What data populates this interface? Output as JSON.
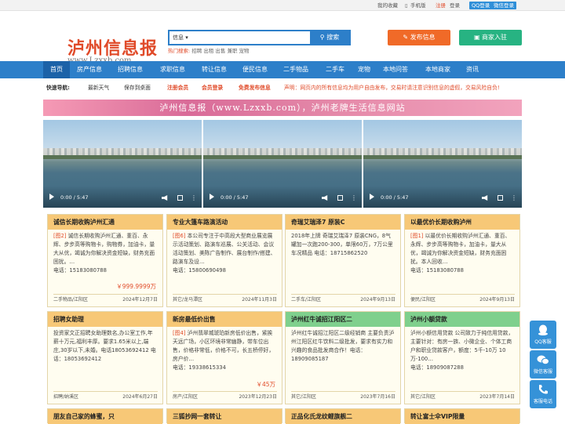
{
  "topbar": {
    "favorite": "我的收藏",
    "mobile": "手机版",
    "register": "注册",
    "login": "登录",
    "qq_login": "QQ登录",
    "wechat_login": "微信登录"
  },
  "logo": {
    "cn": "泸州信息报",
    "en": "www.Lzxxb.com"
  },
  "search": {
    "type": "信息",
    "button": "搜索",
    "placeholder": "",
    "hot_label": "热门搜索:",
    "hot_terms": "招聘 出租 出售 兼职 宠物"
  },
  "actions": {
    "publish": "发布信息",
    "join": "商家入驻"
  },
  "nav": [
    "首页",
    "房产信息",
    "招聘信息",
    "求职信息",
    "转让信息",
    "便民信息",
    "二手物品",
    "二手车",
    "宠物",
    "本地问答",
    "本地商家",
    "资讯"
  ],
  "quick": {
    "label": "快速导航:",
    "weather": "最新天气",
    "save_desktop": "保存到桌面",
    "register": "注册会员",
    "login": "会员登录",
    "free": "免费发布信息",
    "notice": "声明：网页内的所有信息均为用户自由发布，交易时请注意识别信息的虚假，交易风险自负!"
  },
  "banner": "泸州信息报（www.Lzxxb.com），泸州老牌生活信息网站",
  "video": {
    "time": "0:00 / 5:47"
  },
  "cards": [
    {
      "title": "诚信长期收购泸州汇通",
      "tag": "[图2]",
      "body": " 诚信长期收购泸州汇通、重百、永辉、步步高等购物卡，购物券，加油卡，量大从优，竭诚为你解决资金短缺，财务充面困扰。…",
      "phone": "电话：15183080788",
      "price": "￥999.9999万",
      "cat": "二手物品/江阳区",
      "date": "2024年12月7日"
    },
    {
      "title": "专业大篷车路演活动",
      "tag": "[图6]",
      "body": " 本公司专注于中高段大型商业展览展示活动策划、路演车巡展、公关活动、会议活动策划、美陈广告制作、展台制作/搭建、路演车及设…",
      "phone": "电话：15800690498",
      "price": "",
      "cat": "其它/龙马潭区",
      "date": "2024年11月3日"
    },
    {
      "title": "奇瑞艾瑞泽7 原装C",
      "tag": "",
      "body": "2018年上牌 奇瑞艾瑞泽7 原装CNG，8气罐加一次跑200-300，单限60万，7万公里车况精品 电话：18715862520",
      "phone": "",
      "price": "",
      "cat": "二手车/江阳区",
      "date": "2024年9月13日"
    },
    {
      "title": "以最优价长期收购泸州",
      "tag": "[图1]",
      "body": " 以最优价长期收购泸州汇通、重百、永辉、步步高等购物卡，加油卡，量大从优，竭诚为你解决资金短缺，财务充面困扰。本人回收…",
      "phone": "电话：15183080788",
      "price": "",
      "cat": "便民/江阳区",
      "date": "2024年9月13日"
    },
    {
      "title": "招聘女助理",
      "tag": "",
      "body": "投资家文正招聘女助理数名,办公室工作,年薪十万元,福利丰厚。要求1.65米以上,端庄,30岁以下,未婚。电话18053692412 电话：18053692412",
      "phone": "",
      "price": "",
      "cat": "招聘/纳溪区",
      "date": "2024年6月27日"
    },
    {
      "title": "新房最低价出售",
      "tag": "[图4]",
      "body": " 泸州翡翠城琥珀新房低价出售，紧挨天远广场，小区环境非常幽静，带车位出售，价格非常低，价格不可，长五桥停好，房户价…",
      "phone": "电话：19338615334",
      "price": "￥45万",
      "cat": "房产/江阳区",
      "date": "2023年12月23日"
    },
    {
      "title": "泸州红牛诚招江阳区二",
      "tag": "",
      "body": "泸州红牛诚招江阳区二级经销商 主要负责泸州江阳区红牛饮料二级批发，要求有实力和兴趣的食品批发商合作！电话：18909085187",
      "phone": "",
      "price": "",
      "cat": "其它/江阳区",
      "date": "2023年7月16日"
    },
    {
      "title": "泸州小额贷款",
      "tag": "",
      "body": "泸州小额信用贷款 公司致力于纯信用贷款，主要针对：有房一族、小微企业、个体工商户和职业贷款客户，额度：5千-10万 10万-100…",
      "phone": "电话：18909087288",
      "price": "",
      "cat": "其它/江阳区",
      "date": "2023年7月14日"
    },
    {
      "title": "朋友自己家的蜂蜜，只",
      "tag": "",
      "body": "",
      "phone": "",
      "price": "",
      "cat": "",
      "date": ""
    },
    {
      "title": "三狐抄网一套转让",
      "tag": "",
      "body": "",
      "phone": "",
      "price": "",
      "cat": "",
      "date": ""
    },
    {
      "title": "正品化氏龙纹鲤旗舰二",
      "tag": "",
      "body": "",
      "phone": "",
      "price": "",
      "cat": "",
      "date": ""
    },
    {
      "title": "转让富士伞VIP限量",
      "tag": "",
      "body": "",
      "phone": "",
      "price": "",
      "cat": "",
      "date": ""
    }
  ],
  "side": {
    "qq": "QQ客服",
    "wechat": "微信客服",
    "phone": "客服电话"
  },
  "colors": {
    "nav": "#2d7fc9",
    "accent": "#e04b2a",
    "publish": "#f06a28",
    "join": "#27b382"
  }
}
